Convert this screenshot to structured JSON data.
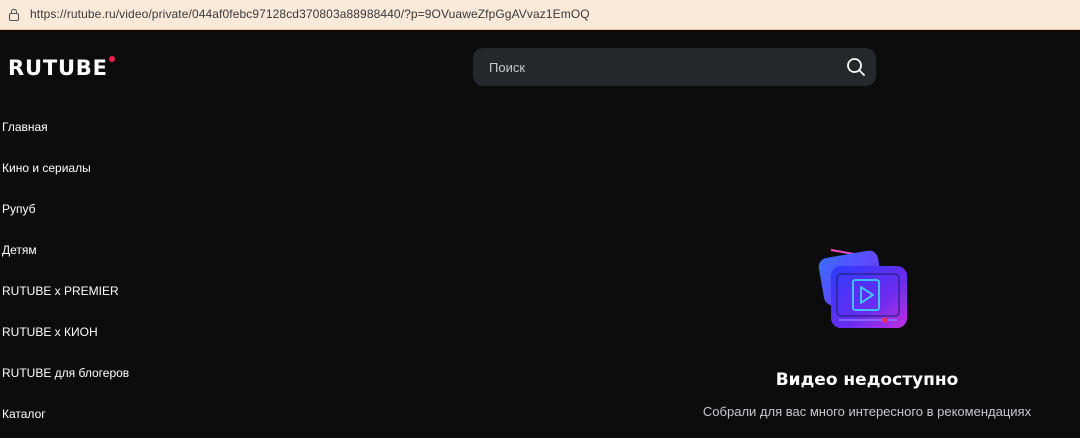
{
  "browser": {
    "url": "https://rutube.ru/video/private/044af0febc97128cd370803a88988440/?p=9OVuaweZfpGgAVvaz1EmOQ"
  },
  "header": {
    "logo_text": "RUTUBE",
    "search": {
      "placeholder": "Поиск",
      "value": ""
    }
  },
  "sidebar": {
    "items": [
      {
        "label": "Главная"
      },
      {
        "label": "Кино и сериалы"
      },
      {
        "label": "Рупуб"
      },
      {
        "label": "Детям"
      },
      {
        "label": "RUTUBE x PREMIER"
      },
      {
        "label": "RUTUBE x КИОН"
      },
      {
        "label": "RUTUBE для блогеров"
      },
      {
        "label": "Каталог"
      }
    ]
  },
  "main": {
    "unavailable_title": "Видео недоступно",
    "unavailable_subtitle": "Собрали для вас много интересного в рекомендациях"
  },
  "colors": {
    "background": "#0c0c0d",
    "search_bg": "#26272b",
    "brand_accent": "#ff1e50",
    "urlbar_bg": "#fbe9da"
  }
}
